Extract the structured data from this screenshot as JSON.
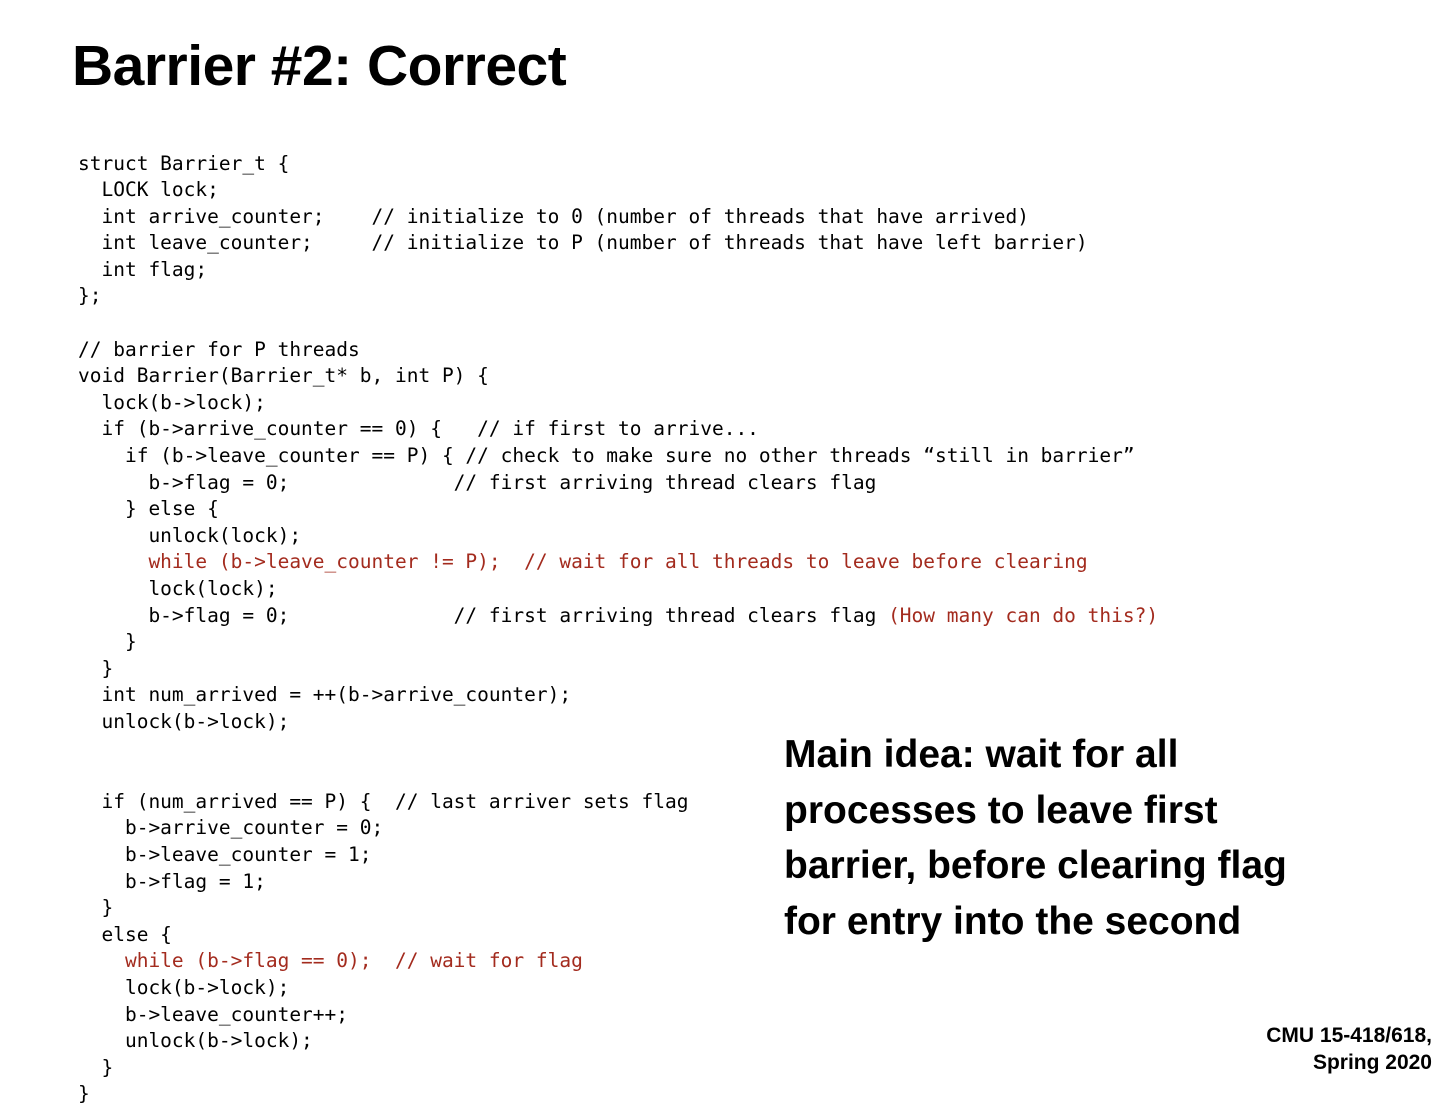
{
  "slide": {
    "title": "Barrier #2: Correct",
    "background_color": "#ffffff",
    "text_color": "#000000",
    "accent_color": "#A32B1E"
  },
  "code": {
    "language": "c",
    "lines": [
      {
        "id": "l01",
        "segments": [
          {
            "text": "struct Barrier_t {",
            "color": "black"
          }
        ]
      },
      {
        "id": "l02",
        "segments": [
          {
            "text": "  LOCK lock;",
            "color": "black"
          }
        ]
      },
      {
        "id": "l03",
        "segments": [
          {
            "text": "  int arrive_counter;    // initialize to 0 (number of threads that have arrived)",
            "color": "black"
          }
        ]
      },
      {
        "id": "l04",
        "segments": [
          {
            "text": "  int leave_counter;     // initialize to P (number of threads that have left barrier)",
            "color": "black"
          }
        ]
      },
      {
        "id": "l05",
        "segments": [
          {
            "text": "  int flag;",
            "color": "black"
          }
        ]
      },
      {
        "id": "l06",
        "segments": [
          {
            "text": "};",
            "color": "black"
          }
        ]
      },
      {
        "id": "l07",
        "blank": true,
        "segments": []
      },
      {
        "id": "l08",
        "segments": [
          {
            "text": "// barrier for P threads",
            "color": "black"
          }
        ]
      },
      {
        "id": "l09",
        "segments": [
          {
            "text": "void Barrier(Barrier_t* b, int P) {",
            "color": "black"
          }
        ]
      },
      {
        "id": "l10",
        "segments": [
          {
            "text": "  lock(b->lock);",
            "color": "black"
          }
        ]
      },
      {
        "id": "l11",
        "segments": [
          {
            "text": "  if (b->arrive_counter == 0) {   // if first to arrive...",
            "color": "black"
          }
        ]
      },
      {
        "id": "l12",
        "segments": [
          {
            "text": "    if (b->leave_counter == P) { // check to make sure no other threads “still in barrier”",
            "color": "black"
          }
        ]
      },
      {
        "id": "l13",
        "segments": [
          {
            "text": "      b->flag = 0;              // first arriving thread clears flag",
            "color": "black"
          }
        ]
      },
      {
        "id": "l14",
        "segments": [
          {
            "text": "    } else {",
            "color": "black"
          }
        ]
      },
      {
        "id": "l15",
        "segments": [
          {
            "text": "      unlock(lock);",
            "color": "black"
          }
        ]
      },
      {
        "id": "l16",
        "segments": [
          {
            "text": "      while (b->leave_counter != P);  // wait for all threads to leave before clearing",
            "color": "red"
          }
        ]
      },
      {
        "id": "l17",
        "segments": [
          {
            "text": "      lock(lock);",
            "color": "black"
          }
        ]
      },
      {
        "id": "l18",
        "segments": [
          {
            "text": "      b->flag = 0;              // first arriving thread clears flag ",
            "color": "black"
          },
          {
            "text": "(How many can do this?)",
            "color": "red"
          }
        ]
      },
      {
        "id": "l19",
        "segments": [
          {
            "text": "    }",
            "color": "black"
          }
        ]
      },
      {
        "id": "l20",
        "segments": [
          {
            "text": "  }",
            "color": "black"
          }
        ]
      },
      {
        "id": "l21",
        "segments": [
          {
            "text": "  int num_arrived = ++(b->arrive_counter);",
            "color": "black"
          }
        ]
      },
      {
        "id": "l22",
        "segments": [
          {
            "text": "  unlock(b->lock);",
            "color": "black"
          }
        ]
      },
      {
        "id": "l23",
        "blank": true,
        "segments": []
      },
      {
        "id": "l24",
        "blank": true,
        "segments": []
      },
      {
        "id": "l25",
        "segments": [
          {
            "text": "  if (num_arrived == P) {  // last arriver sets flag",
            "color": "black"
          }
        ]
      },
      {
        "id": "l26",
        "segments": [
          {
            "text": "    b->arrive_counter = 0;",
            "color": "black"
          }
        ]
      },
      {
        "id": "l27",
        "segments": [
          {
            "text": "    b->leave_counter = 1;",
            "color": "black"
          }
        ]
      },
      {
        "id": "l28",
        "segments": [
          {
            "text": "    b->flag = 1;",
            "color": "black"
          }
        ]
      },
      {
        "id": "l29",
        "segments": [
          {
            "text": "  }",
            "color": "black"
          }
        ]
      },
      {
        "id": "l30",
        "segments": [
          {
            "text": "  else {",
            "color": "black"
          }
        ]
      },
      {
        "id": "l31",
        "segments": [
          {
            "text": "    while (b->flag == 0);  // wait for flag",
            "color": "red"
          }
        ]
      },
      {
        "id": "l32",
        "segments": [
          {
            "text": "    lock(b->lock);",
            "color": "black"
          }
        ]
      },
      {
        "id": "l33",
        "segments": [
          {
            "text": "    b->leave_counter++;",
            "color": "black"
          }
        ]
      },
      {
        "id": "l34",
        "segments": [
          {
            "text": "    unlock(b->lock);",
            "color": "black"
          }
        ]
      },
      {
        "id": "l35",
        "segments": [
          {
            "text": "  }",
            "color": "black"
          }
        ]
      },
      {
        "id": "l36",
        "segments": [
          {
            "text": "}",
            "color": "black"
          }
        ]
      }
    ]
  },
  "main_idea": {
    "text": "Main idea: wait for all processes to leave first barrier, before clearing flag for entry into the second"
  },
  "footer": {
    "line1": "CMU 15-418/618,",
    "line2": "Spring 2020"
  }
}
